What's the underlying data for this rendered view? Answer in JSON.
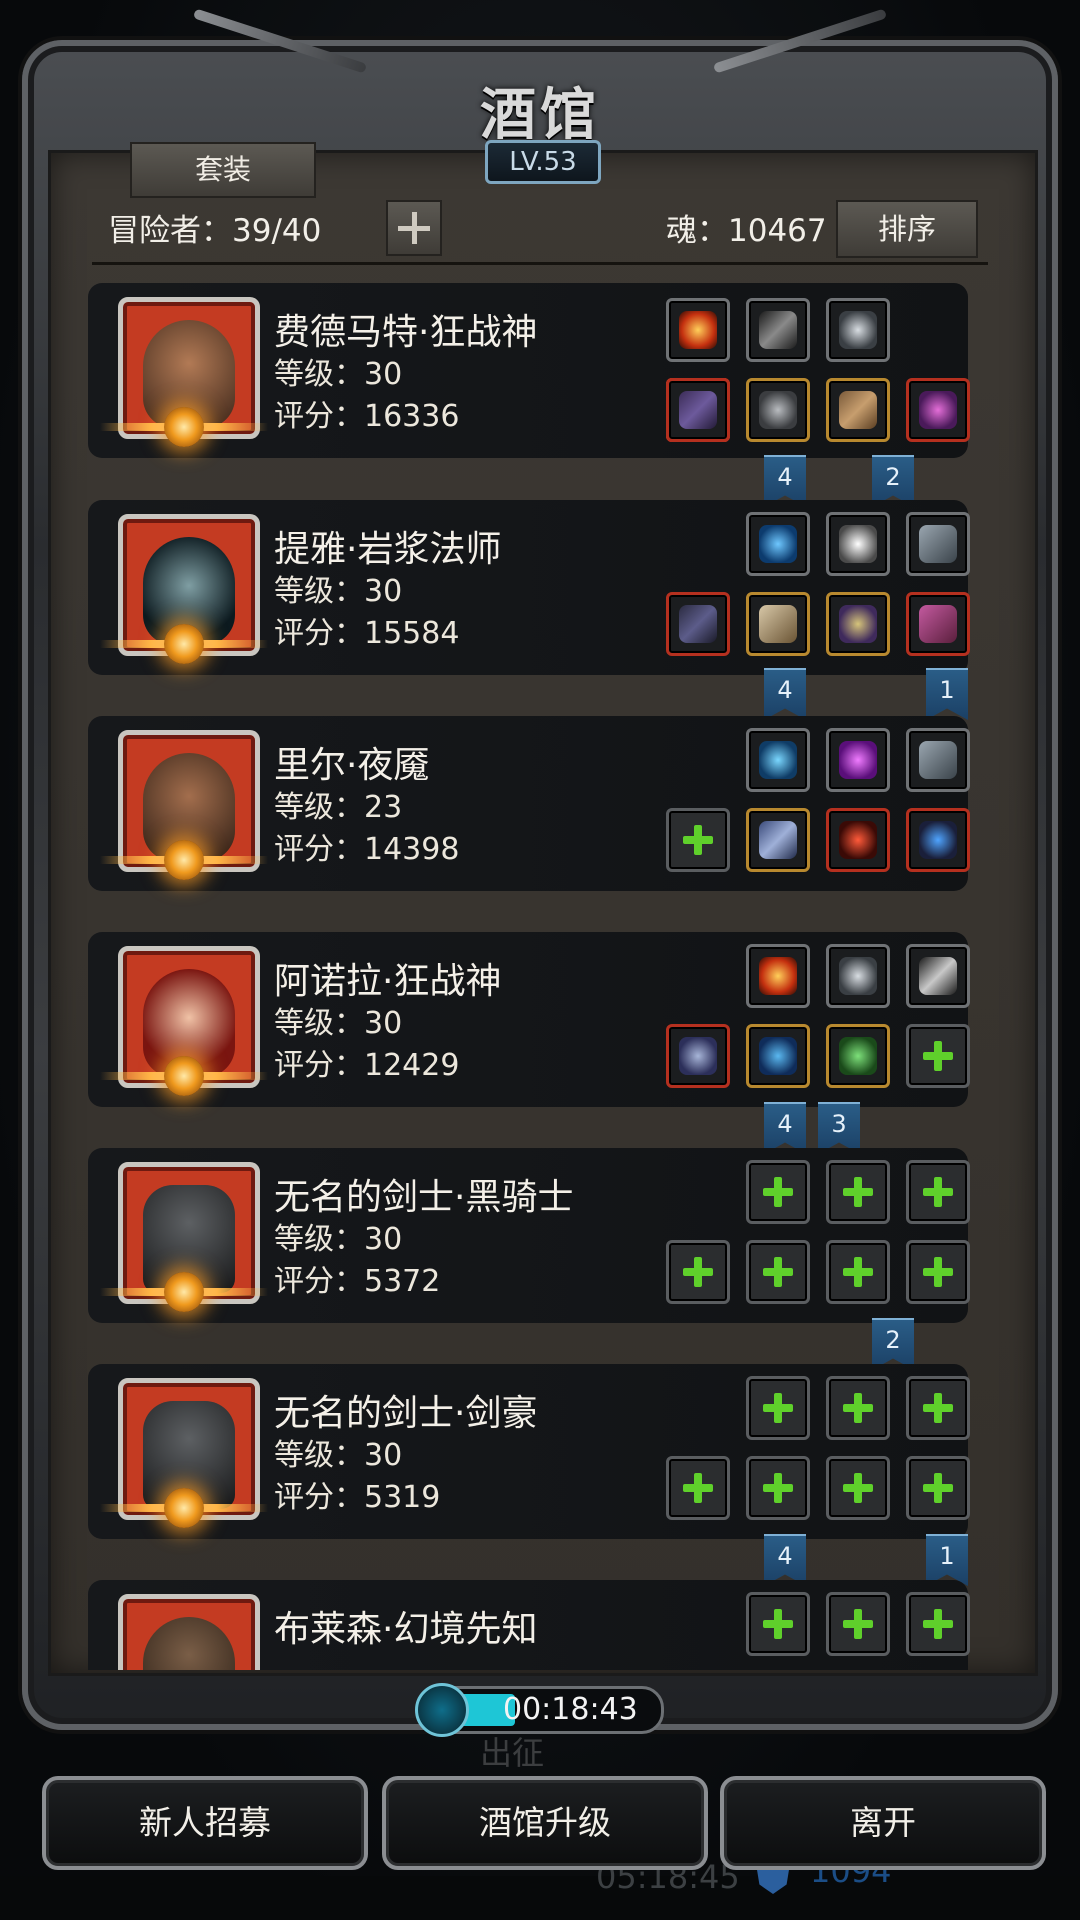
{
  "header": {
    "title": "酒馆",
    "level": "LV.53"
  },
  "controls": {
    "set_label": "套装",
    "adventurers": "冒险者：39/40",
    "soul": "魂：10467",
    "sort_label": "排序"
  },
  "heroes": [
    {
      "name": "费德马特·狂战神",
      "level": "等级：30",
      "score": "评分：16336",
      "marks": [
        "4",
        "2"
      ]
    },
    {
      "name": "提雅·岩浆法师",
      "level": "等级：30",
      "score": "评分：15584",
      "marks": [
        "4",
        "1"
      ]
    },
    {
      "name": "里尔·夜魇",
      "level": "等级：23",
      "score": "评分：14398",
      "marks": []
    },
    {
      "name": "阿诺拉·狂战神",
      "level": "等级：30",
      "score": "评分：12429",
      "marks": [
        "4",
        "3"
      ]
    },
    {
      "name": "无名的剑士·黑骑士",
      "level": "等级：30",
      "score": "评分：5372",
      "marks": [
        "2"
      ]
    },
    {
      "name": "无名的剑士·剑豪",
      "level": "等级：30",
      "score": "评分：5319",
      "marks": [
        "4",
        "1"
      ]
    },
    {
      "name": "布莱森·幻境先知",
      "level": "",
      "score": "",
      "marks": []
    }
  ],
  "timer": {
    "time": "00:18:43"
  },
  "background": {
    "sortie": "出征",
    "time": "05:18:45",
    "count": "1094"
  },
  "buttons": {
    "recruit": "新人招募",
    "upgrade": "酒馆升级",
    "leave": "离开"
  },
  "icons": [
    "shield-icon",
    "plus-icon",
    "gem-icon",
    "sword-icon",
    "armor-icon",
    "clock-icon"
  ],
  "colors": {
    "accent_blue": "#2a5d87",
    "empty_slot_plus": "#5fd02b",
    "portrait_red": "#c43b22"
  }
}
